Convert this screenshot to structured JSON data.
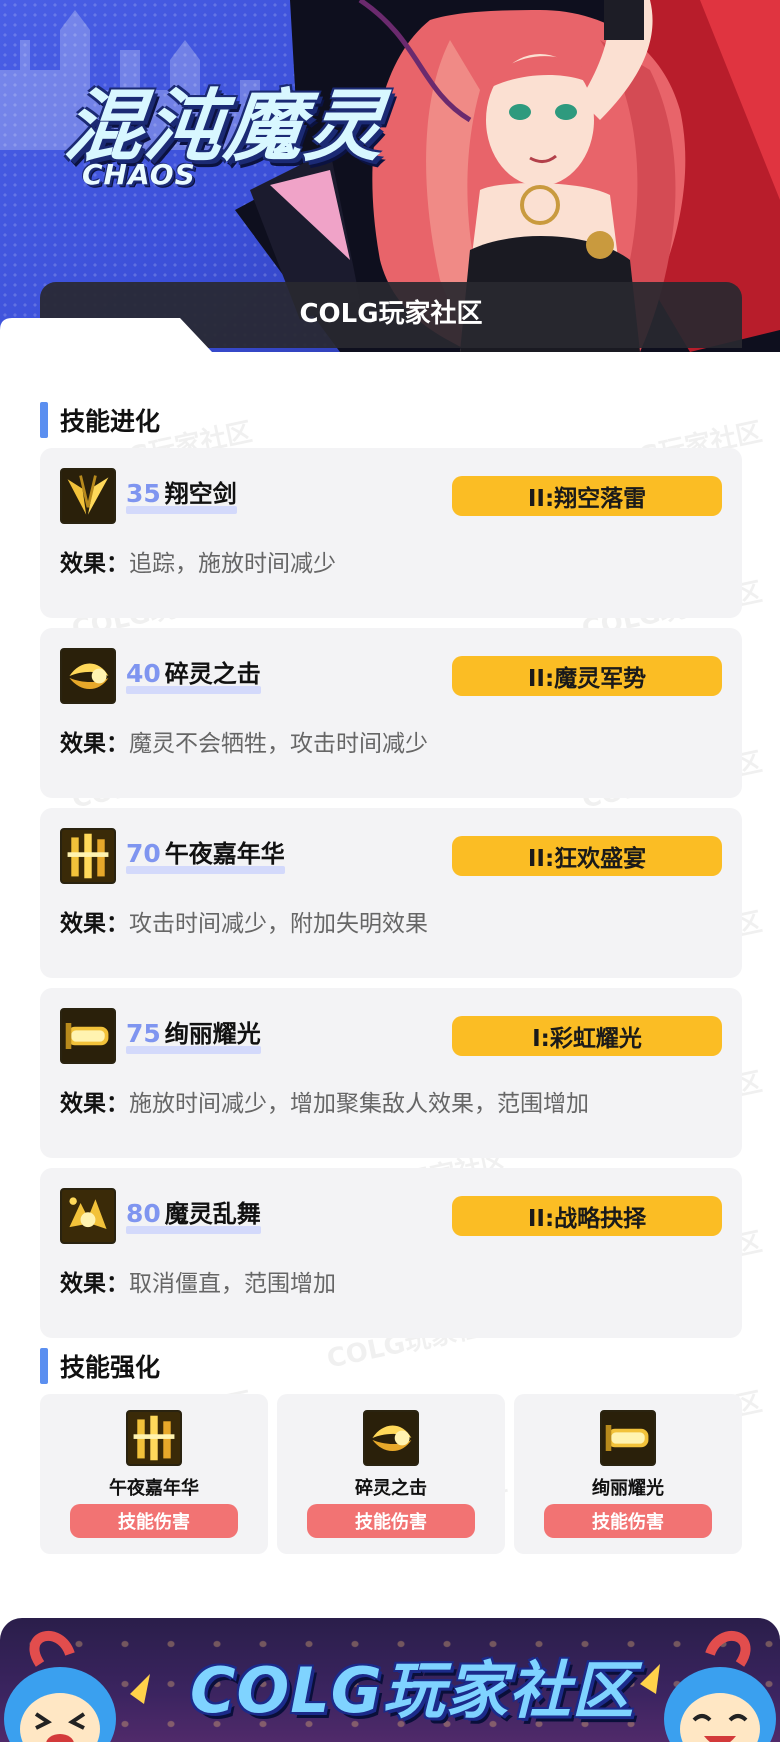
{
  "banner": {
    "title_cn": "混沌魔灵",
    "title_en": "CHAOS",
    "community_label": "COLG玩家社区"
  },
  "watermark_text": "COLG玩家社区",
  "evolution": {
    "section_title": "技能进化",
    "effect_label": "效果：",
    "skills": [
      {
        "level": "35",
        "name": "翔空剑",
        "evolution": "II:翔空落雷",
        "effect": "追踪，施放时间减少",
        "icon": "sword-slash-icon"
      },
      {
        "level": "40",
        "name": "碎灵之击",
        "evolution": "II:魔灵军势",
        "effect": "魔灵不会牺牲，攻击时间减少",
        "icon": "spirit-burst-icon"
      },
      {
        "level": "70",
        "name": "午夜嘉年华",
        "evolution": "II:狂欢盛宴",
        "effect": "攻击时间减少，附加失明效果",
        "icon": "midnight-carnival-icon"
      },
      {
        "level": "75",
        "name": "绚丽耀光",
        "evolution": "I:彩虹耀光",
        "effect": "施放时间减少，增加聚集敌人效果，范围增加",
        "icon": "radiant-beam-icon"
      },
      {
        "level": "80",
        "name": "魔灵乱舞",
        "evolution": "II:战略抉择",
        "effect": "取消僵直，范围增加",
        "icon": "spirit-dance-icon"
      }
    ]
  },
  "enhancement": {
    "section_title": "技能强化",
    "items": [
      {
        "name": "午夜嘉年华",
        "button": "技能伤害",
        "icon": "midnight-carnival-icon"
      },
      {
        "name": "碎灵之击",
        "button": "技能伤害",
        "icon": "spirit-burst-icon"
      },
      {
        "name": "绚丽耀光",
        "button": "技能伤害",
        "icon": "radiant-beam-icon"
      }
    ]
  },
  "footer": {
    "title": "COLG玩家社区"
  },
  "colors": {
    "accent_blue": "#5b8ff0",
    "level_blue": "#7f95f0",
    "evolution_tag": "#fbbd24",
    "damage_button": "#f27373",
    "card_bg": "#f3f3f5"
  }
}
